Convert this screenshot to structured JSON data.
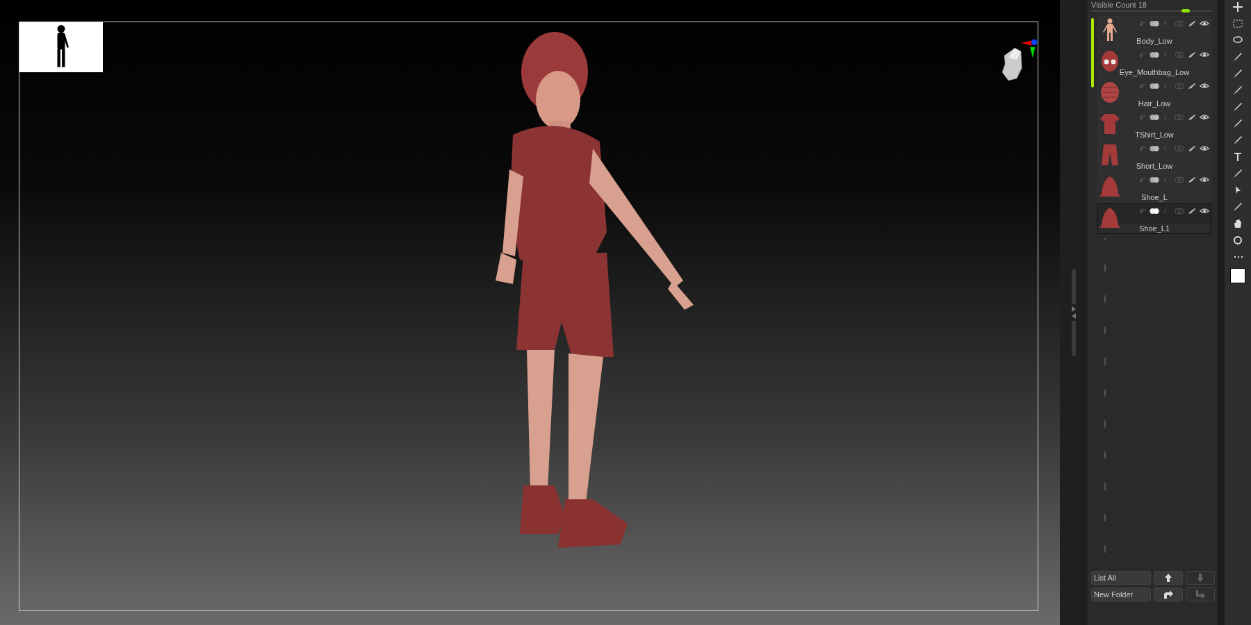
{
  "subtool_panel": {
    "header": "Visible Count 18",
    "visible_count_slider": {
      "level": 0.78
    },
    "items": [
      {
        "name": "Body_Low",
        "kind": "body",
        "selected": false
      },
      {
        "name": "Eye_Mouthbag_Low",
        "kind": "head",
        "selected": false
      },
      {
        "name": "Hair_Low",
        "kind": "hair",
        "selected": false
      },
      {
        "name": "TShirt_Low",
        "kind": "shirt",
        "selected": false
      },
      {
        "name": "Short_Low",
        "kind": "shorts",
        "selected": false
      },
      {
        "name": "Shoe_L",
        "kind": "shoe",
        "selected": false
      },
      {
        "name": "Shoe_L1",
        "kind": "shoe",
        "selected": true
      }
    ],
    "buttons": [
      "List All",
      "New Folder"
    ]
  }
}
